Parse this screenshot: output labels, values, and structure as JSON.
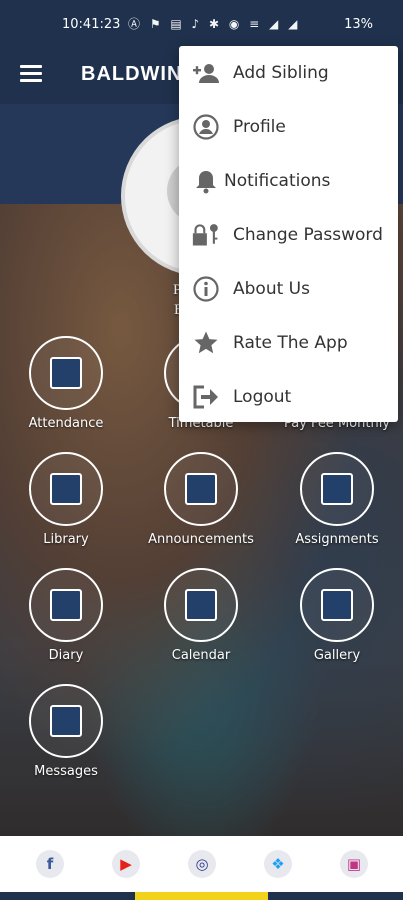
{
  "status_bar": {
    "time": "10:41:23",
    "battery": "13%",
    "icons": "Ⓐ ⚑ ▤ ♪ ✱ ◉ ≡ ◢ ◢"
  },
  "app_bar": {
    "title": "BALDWIN"
  },
  "student": {
    "name": "PRIYA K",
    "school": "BALDW"
  },
  "menu": [
    {
      "label": "Add Sibling",
      "icon": "add-person-icon"
    },
    {
      "label": "Profile",
      "icon": "profile-icon"
    },
    {
      "label": "Notifications",
      "icon": "bell-icon"
    },
    {
      "label": "Change Password",
      "icon": "lock-key-icon"
    },
    {
      "label": "About Us",
      "icon": "info-icon"
    },
    {
      "label": "Rate The App",
      "icon": "star-icon"
    },
    {
      "label": "Logout",
      "icon": "logout-icon"
    }
  ],
  "tiles": [
    {
      "label": "Attendance",
      "icon": "attendance-icon"
    },
    {
      "label": "Timetable",
      "icon": "timetable-icon"
    },
    {
      "label": "Pay Fee Monthly",
      "icon": "fee-icon"
    },
    {
      "label": "Library",
      "icon": "library-icon"
    },
    {
      "label": "Announcements",
      "icon": "megaphone-icon"
    },
    {
      "label": "Assignments",
      "icon": "assignment-icon"
    },
    {
      "label": "Diary",
      "icon": "diary-icon"
    },
    {
      "label": "Calendar",
      "icon": "calendar-icon"
    },
    {
      "label": "Gallery",
      "icon": "gallery-icon"
    },
    {
      "label": "Messages",
      "icon": "mail-icon"
    }
  ],
  "social": [
    {
      "glyph": "f",
      "icon": "facebook-icon",
      "color": "#3b5998"
    },
    {
      "glyph": "▶",
      "icon": "youtube-icon",
      "color": "#e62117"
    },
    {
      "glyph": "◎",
      "icon": "website-icon",
      "color": "#2d3b8c"
    },
    {
      "glyph": "❖",
      "icon": "twitter-icon",
      "color": "#1da1f2"
    },
    {
      "glyph": "▣",
      "icon": "instagram-icon",
      "color": "#c13584"
    }
  ]
}
